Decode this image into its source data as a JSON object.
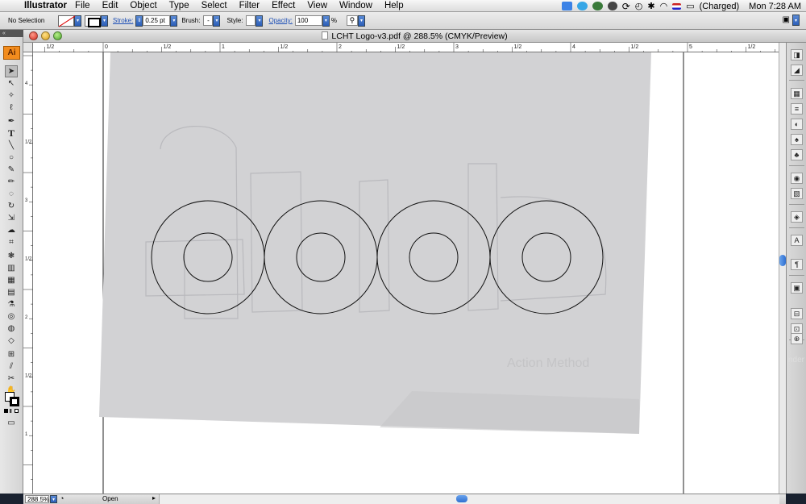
{
  "menubar": {
    "app_name": "Illustrator",
    "items": [
      "File",
      "Edit",
      "Object",
      "Type",
      "Select",
      "Filter",
      "Effect",
      "View",
      "Window",
      "Help"
    ],
    "battery_status": "(Charged)",
    "clock": "Mon 7:28 AM"
  },
  "controlbar": {
    "selection_status": "No Selection",
    "stroke_label": "Stroke:",
    "stroke_weight": "0.25 pt",
    "brush_label": "Brush:",
    "brush_value": "-",
    "style_label": "Style:",
    "opacity_label": "Opacity:",
    "opacity_value": "100",
    "opacity_unit": "%"
  },
  "document": {
    "title": "LCHT Logo-v3.pdf @ 288.5% (CMYK/Preview)",
    "placed_image_faint_text": "Action Method"
  },
  "rulers": {
    "top_labels": [
      "1/2",
      "0",
      "1/2",
      "1",
      "1/2",
      "2",
      "1/2",
      "3",
      "1/2",
      "4",
      "1/2",
      "5",
      "1/2"
    ],
    "left_labels": [
      "4",
      "1/2",
      "3",
      "1/2",
      "2",
      "1/2",
      "1"
    ]
  },
  "statusbar": {
    "zoom": "288.5%",
    "status": "Open"
  },
  "desktop": {
    "partial_text": "nder"
  },
  "tools": [
    "selection-tool",
    "direct-selection-tool",
    "magic-wand-tool",
    "lasso-tool",
    "pen-tool",
    "type-tool",
    "line-tool",
    "ellipse-tool",
    "paintbrush-tool",
    "pencil-tool",
    "blob-brush-tool",
    "rotate-tool",
    "scale-tool",
    "warp-tool",
    "free-transform-tool",
    "symbol-sprayer-tool",
    "column-graph-tool",
    "mesh-tool",
    "gradient-tool",
    "eyedropper-tool",
    "blend-tool",
    "live-paint-tool",
    "live-paint-selection-tool",
    "artboard-tool",
    "slice-tool",
    "eraser-tool",
    "scissors-tool",
    "hand-tool",
    "zoom-tool"
  ],
  "colors": {
    "accent_orange": "#f28c1e",
    "selection_blue": "#2f6fd0"
  }
}
